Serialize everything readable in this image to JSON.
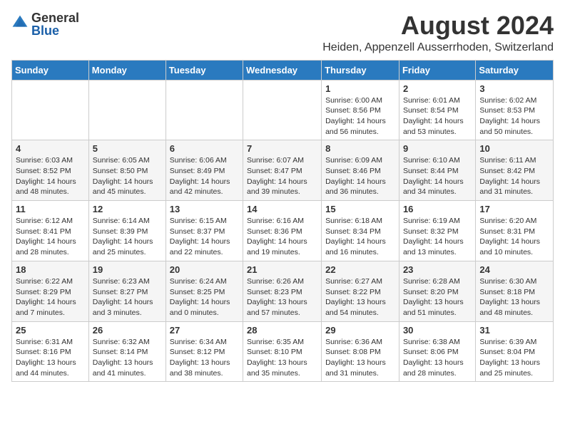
{
  "logo": {
    "general": "General",
    "blue": "Blue"
  },
  "title": "August 2024",
  "location": "Heiden, Appenzell Ausserrhoden, Switzerland",
  "weekdays": [
    "Sunday",
    "Monday",
    "Tuesday",
    "Wednesday",
    "Thursday",
    "Friday",
    "Saturday"
  ],
  "weeks": [
    [
      {
        "day": "",
        "info": ""
      },
      {
        "day": "",
        "info": ""
      },
      {
        "day": "",
        "info": ""
      },
      {
        "day": "",
        "info": ""
      },
      {
        "day": "1",
        "info": "Sunrise: 6:00 AM\nSunset: 8:56 PM\nDaylight: 14 hours and 56 minutes."
      },
      {
        "day": "2",
        "info": "Sunrise: 6:01 AM\nSunset: 8:54 PM\nDaylight: 14 hours and 53 minutes."
      },
      {
        "day": "3",
        "info": "Sunrise: 6:02 AM\nSunset: 8:53 PM\nDaylight: 14 hours and 50 minutes."
      }
    ],
    [
      {
        "day": "4",
        "info": "Sunrise: 6:03 AM\nSunset: 8:52 PM\nDaylight: 14 hours and 48 minutes."
      },
      {
        "day": "5",
        "info": "Sunrise: 6:05 AM\nSunset: 8:50 PM\nDaylight: 14 hours and 45 minutes."
      },
      {
        "day": "6",
        "info": "Sunrise: 6:06 AM\nSunset: 8:49 PM\nDaylight: 14 hours and 42 minutes."
      },
      {
        "day": "7",
        "info": "Sunrise: 6:07 AM\nSunset: 8:47 PM\nDaylight: 14 hours and 39 minutes."
      },
      {
        "day": "8",
        "info": "Sunrise: 6:09 AM\nSunset: 8:46 PM\nDaylight: 14 hours and 36 minutes."
      },
      {
        "day": "9",
        "info": "Sunrise: 6:10 AM\nSunset: 8:44 PM\nDaylight: 14 hours and 34 minutes."
      },
      {
        "day": "10",
        "info": "Sunrise: 6:11 AM\nSunset: 8:42 PM\nDaylight: 14 hours and 31 minutes."
      }
    ],
    [
      {
        "day": "11",
        "info": "Sunrise: 6:12 AM\nSunset: 8:41 PM\nDaylight: 14 hours and 28 minutes."
      },
      {
        "day": "12",
        "info": "Sunrise: 6:14 AM\nSunset: 8:39 PM\nDaylight: 14 hours and 25 minutes."
      },
      {
        "day": "13",
        "info": "Sunrise: 6:15 AM\nSunset: 8:37 PM\nDaylight: 14 hours and 22 minutes."
      },
      {
        "day": "14",
        "info": "Sunrise: 6:16 AM\nSunset: 8:36 PM\nDaylight: 14 hours and 19 minutes."
      },
      {
        "day": "15",
        "info": "Sunrise: 6:18 AM\nSunset: 8:34 PM\nDaylight: 14 hours and 16 minutes."
      },
      {
        "day": "16",
        "info": "Sunrise: 6:19 AM\nSunset: 8:32 PM\nDaylight: 14 hours and 13 minutes."
      },
      {
        "day": "17",
        "info": "Sunrise: 6:20 AM\nSunset: 8:31 PM\nDaylight: 14 hours and 10 minutes."
      }
    ],
    [
      {
        "day": "18",
        "info": "Sunrise: 6:22 AM\nSunset: 8:29 PM\nDaylight: 14 hours and 7 minutes."
      },
      {
        "day": "19",
        "info": "Sunrise: 6:23 AM\nSunset: 8:27 PM\nDaylight: 14 hours and 3 minutes."
      },
      {
        "day": "20",
        "info": "Sunrise: 6:24 AM\nSunset: 8:25 PM\nDaylight: 14 hours and 0 minutes."
      },
      {
        "day": "21",
        "info": "Sunrise: 6:26 AM\nSunset: 8:23 PM\nDaylight: 13 hours and 57 minutes."
      },
      {
        "day": "22",
        "info": "Sunrise: 6:27 AM\nSunset: 8:22 PM\nDaylight: 13 hours and 54 minutes."
      },
      {
        "day": "23",
        "info": "Sunrise: 6:28 AM\nSunset: 8:20 PM\nDaylight: 13 hours and 51 minutes."
      },
      {
        "day": "24",
        "info": "Sunrise: 6:30 AM\nSunset: 8:18 PM\nDaylight: 13 hours and 48 minutes."
      }
    ],
    [
      {
        "day": "25",
        "info": "Sunrise: 6:31 AM\nSunset: 8:16 PM\nDaylight: 13 hours and 44 minutes."
      },
      {
        "day": "26",
        "info": "Sunrise: 6:32 AM\nSunset: 8:14 PM\nDaylight: 13 hours and 41 minutes."
      },
      {
        "day": "27",
        "info": "Sunrise: 6:34 AM\nSunset: 8:12 PM\nDaylight: 13 hours and 38 minutes."
      },
      {
        "day": "28",
        "info": "Sunrise: 6:35 AM\nSunset: 8:10 PM\nDaylight: 13 hours and 35 minutes."
      },
      {
        "day": "29",
        "info": "Sunrise: 6:36 AM\nSunset: 8:08 PM\nDaylight: 13 hours and 31 minutes."
      },
      {
        "day": "30",
        "info": "Sunrise: 6:38 AM\nSunset: 8:06 PM\nDaylight: 13 hours and 28 minutes."
      },
      {
        "day": "31",
        "info": "Sunrise: 6:39 AM\nSunset: 8:04 PM\nDaylight: 13 hours and 25 minutes."
      }
    ]
  ]
}
